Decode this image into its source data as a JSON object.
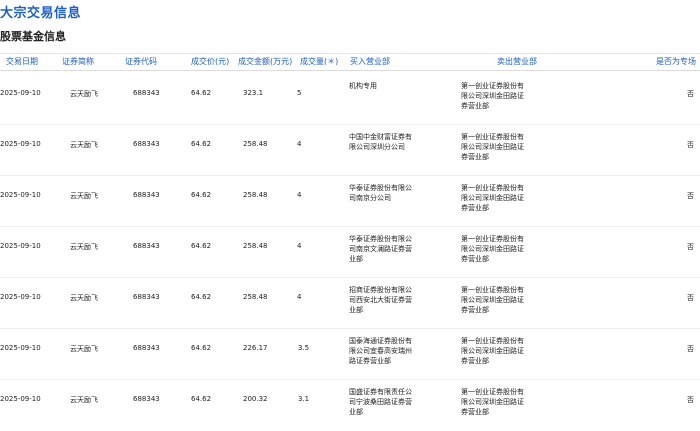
{
  "page": {
    "title": "大宗交易信息",
    "section": "股票基金信息"
  },
  "columns": {
    "date": "交易日期",
    "name": "证券简称",
    "code": "证券代码",
    "price": "成交价(元)",
    "amount": "成交金额(万元)",
    "volume": "成交量(＊)",
    "buyer": "买入营业部",
    "seller": "卖出营业部",
    "special": "是否为专场"
  },
  "rows": [
    {
      "date": "2025-09-10",
      "name": "云天励飞",
      "code": "688343",
      "price": "64.62",
      "amount": "323.1",
      "volume": "5",
      "buyer": "机构专用",
      "seller": "第一创业证券股份有限公司深圳金田路证券营业部",
      "special": "否"
    },
    {
      "date": "2025-09-10",
      "name": "云天励飞",
      "code": "688343",
      "price": "64.62",
      "amount": "258.48",
      "volume": "4",
      "buyer": "中国中金财富证券有限公司深圳分公司",
      "seller": "第一创业证券股份有限公司深圳金田路证券营业部",
      "special": "否"
    },
    {
      "date": "2025-09-10",
      "name": "云天励飞",
      "code": "688343",
      "price": "64.62",
      "amount": "258.48",
      "volume": "4",
      "buyer": "华泰证券股份有限公司南京分公司",
      "seller": "第一创业证券股份有限公司深圳金田路证券营业部",
      "special": "否"
    },
    {
      "date": "2025-09-10",
      "name": "云天励飞",
      "code": "688343",
      "price": "64.62",
      "amount": "258.48",
      "volume": "4",
      "buyer": "华泰证券股份有限公司南京文澜路证券营业部",
      "seller": "第一创业证券股份有限公司深圳金田路证券营业部",
      "special": "否"
    },
    {
      "date": "2025-09-10",
      "name": "云天励飞",
      "code": "688343",
      "price": "64.62",
      "amount": "258.48",
      "volume": "4",
      "buyer": "招商证券股份有限公司西安北大街证券营业部",
      "seller": "第一创业证券股份有限公司深圳金田路证券营业部",
      "special": "否"
    },
    {
      "date": "2025-09-10",
      "name": "云天励飞",
      "code": "688343",
      "price": "64.62",
      "amount": "226.17",
      "volume": "3.5",
      "buyer": "国泰海通证券股份有限公司宜春高安瑞州路证券营业部",
      "seller": "第一创业证券股份有限公司深圳金田路证券营业部",
      "special": "否"
    },
    {
      "date": "2025-09-10",
      "name": "云天励飞",
      "code": "688343",
      "price": "64.62",
      "amount": "200.32",
      "volume": "3.1",
      "buyer": "国盛证券有限责任公司宁波桑田路证券营业部",
      "seller": "第一创业证券股份有限公司深圳金田路证券营业部",
      "special": "否"
    }
  ]
}
